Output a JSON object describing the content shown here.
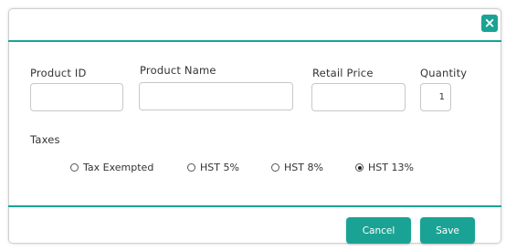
{
  "dialog": {
    "close_label": "×",
    "fields": {
      "product_id": {
        "label": "Product ID",
        "value": ""
      },
      "product_name": {
        "label": "Product Name",
        "value": ""
      },
      "retail_price": {
        "label": "Retail Price",
        "value": ""
      },
      "quantity": {
        "label": "Quantity",
        "value": "1"
      }
    },
    "taxes": {
      "label": "Taxes",
      "options": [
        {
          "label": "Tax Exempted",
          "checked": false
        },
        {
          "label": "HST 5%",
          "checked": false
        },
        {
          "label": "HST 8%",
          "checked": false
        },
        {
          "label": "HST 13%",
          "checked": true
        }
      ]
    },
    "buttons": {
      "cancel": "Cancel",
      "save": "Save"
    }
  },
  "colors": {
    "accent": "#1aa394"
  }
}
